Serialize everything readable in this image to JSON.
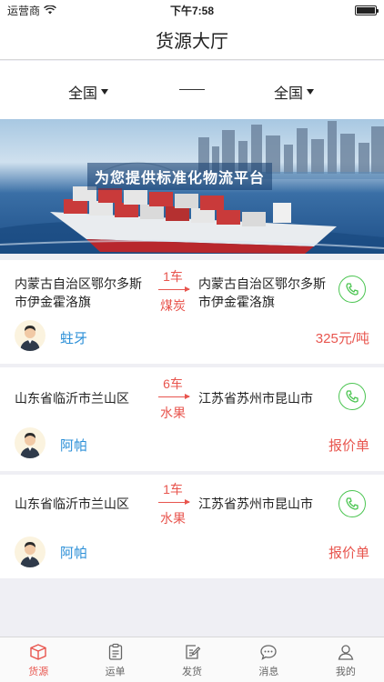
{
  "status_bar": {
    "carrier": "运营商",
    "time": "下午7:58"
  },
  "nav": {
    "title": "货源大厅"
  },
  "filter": {
    "from_region": "全国",
    "to_region": "全国"
  },
  "banner": {
    "slogan": "为您提供标准化物流平台"
  },
  "cargo_list": [
    {
      "from": "内蒙古自治区鄂尔多斯市伊金霍洛旗",
      "to": "内蒙古自治区鄂尔多斯市伊金霍洛旗",
      "quantity": "1车",
      "goods": "煤炭",
      "shipper": "蛀牙",
      "price": "325元/吨"
    },
    {
      "from": "山东省临沂市兰山区",
      "to": "江苏省苏州市昆山市",
      "quantity": "6车",
      "goods": "水果",
      "shipper": "阿帕",
      "price": "报价单"
    },
    {
      "from": "山东省临沂市兰山区",
      "to": "江苏省苏州市昆山市",
      "quantity": "1车",
      "goods": "水果",
      "shipper": "阿帕",
      "price": "报价单"
    }
  ],
  "tabs": [
    {
      "label": "货源",
      "icon": "box-icon",
      "active": true
    },
    {
      "label": "运单",
      "icon": "clipboard-icon",
      "active": false
    },
    {
      "label": "发货",
      "icon": "edit-document-icon",
      "active": false
    },
    {
      "label": "消息",
      "icon": "chat-bubble-icon",
      "active": false
    },
    {
      "label": "我的",
      "icon": "user-icon",
      "active": false
    }
  ],
  "colors": {
    "accent": "#e8554e",
    "link": "#2b8fd7",
    "phone": "#4cc552"
  }
}
